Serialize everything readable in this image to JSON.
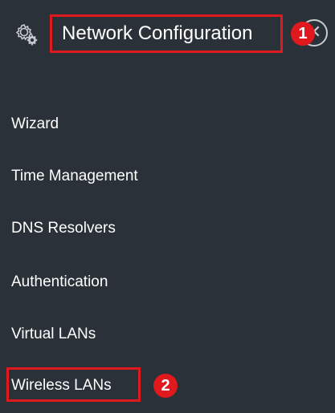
{
  "header": {
    "title": "Network Configuration",
    "icon": "gear-icon",
    "close_symbol": "✕"
  },
  "annotations": {
    "badge_1": "1",
    "badge_2": "2",
    "highlight_color": "#e0191e"
  },
  "menu": {
    "items": [
      {
        "label": "Wizard"
      },
      {
        "label": "Time Management"
      },
      {
        "label": "DNS Resolvers"
      },
      {
        "label": "Authentication"
      },
      {
        "label": "Virtual LANs"
      },
      {
        "label": "Wireless LANs"
      }
    ]
  },
  "colors": {
    "background": "#2b3138",
    "text": "#ffffff"
  }
}
